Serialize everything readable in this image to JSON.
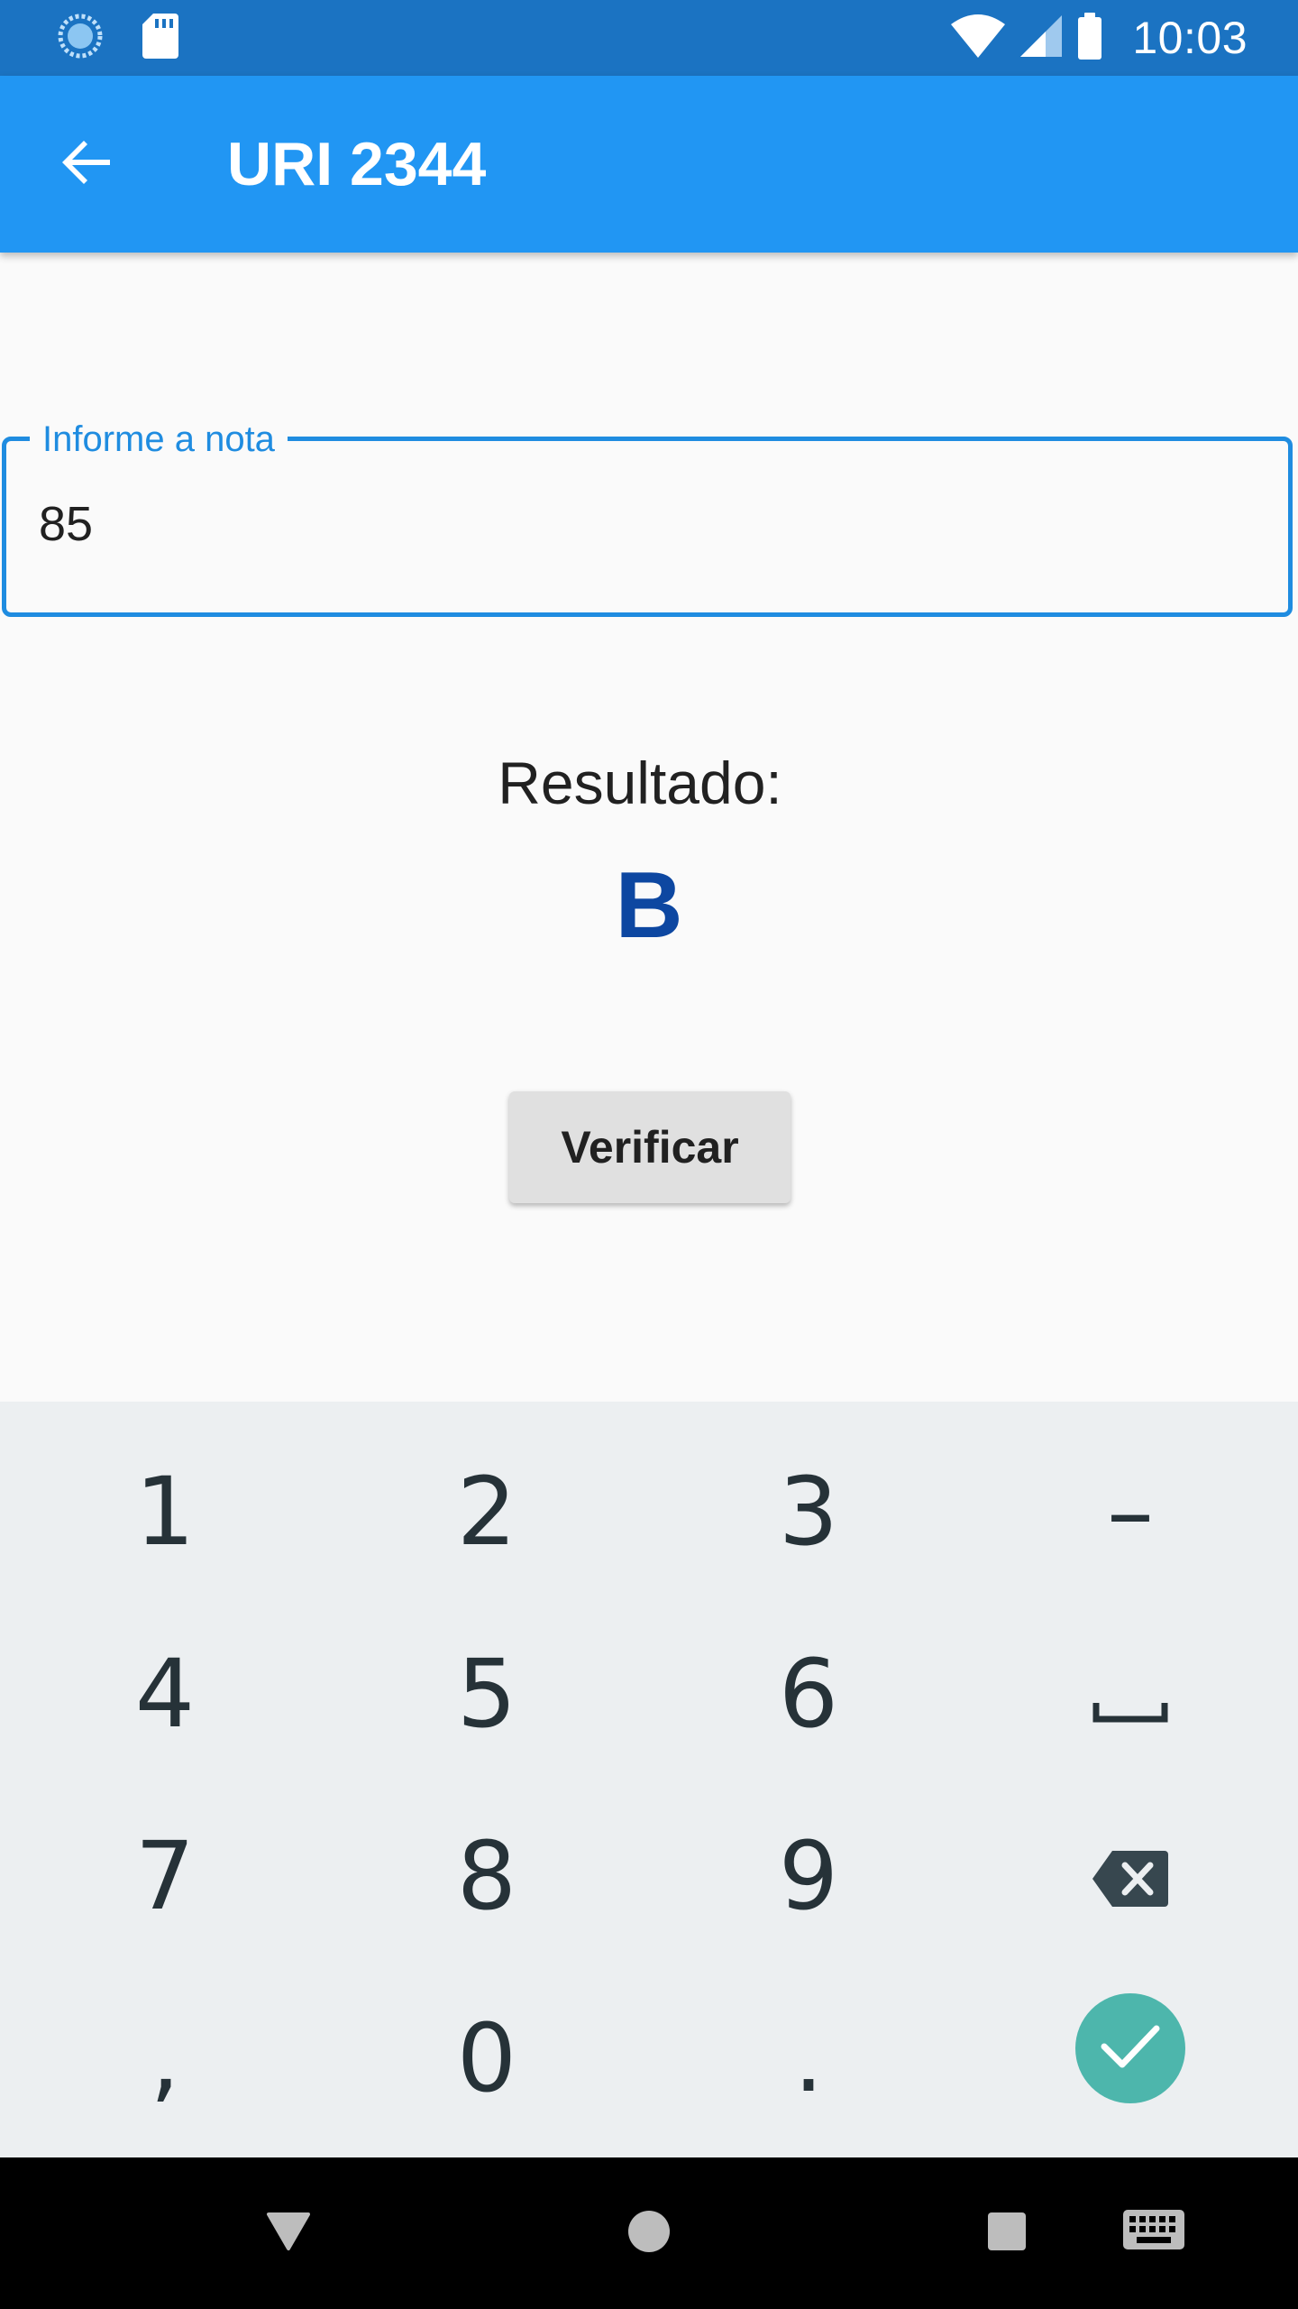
{
  "status_bar": {
    "time": "10:03",
    "left_icons": [
      "sync-icon",
      "sd-card-icon"
    ],
    "right_icons": [
      "wifi-icon",
      "cell-signal-icon",
      "battery-icon"
    ]
  },
  "app_bar": {
    "title": "URI 2344",
    "back_icon": "arrow-back-icon",
    "color": "#2196f3"
  },
  "form": {
    "field_label": "Informe a nota",
    "field_value": "85",
    "accent_color": "#1f8ce0"
  },
  "result": {
    "label": "Resultado:",
    "value": "B",
    "value_color": "#0d47a1"
  },
  "verify_button": {
    "label": "Verificar"
  },
  "keyboard": {
    "keys": [
      [
        "1",
        "2",
        "3",
        "–"
      ],
      [
        "4",
        "5",
        "6",
        "space"
      ],
      [
        "7",
        "8",
        "9",
        "backspace"
      ],
      [
        ",",
        "0",
        ".",
        "done"
      ]
    ],
    "done_color": "#4db6ac"
  },
  "nav_bar": {
    "items": [
      "back-triangle-icon",
      "home-circle-icon",
      "recents-square-icon",
      "keyboard-icon"
    ]
  }
}
